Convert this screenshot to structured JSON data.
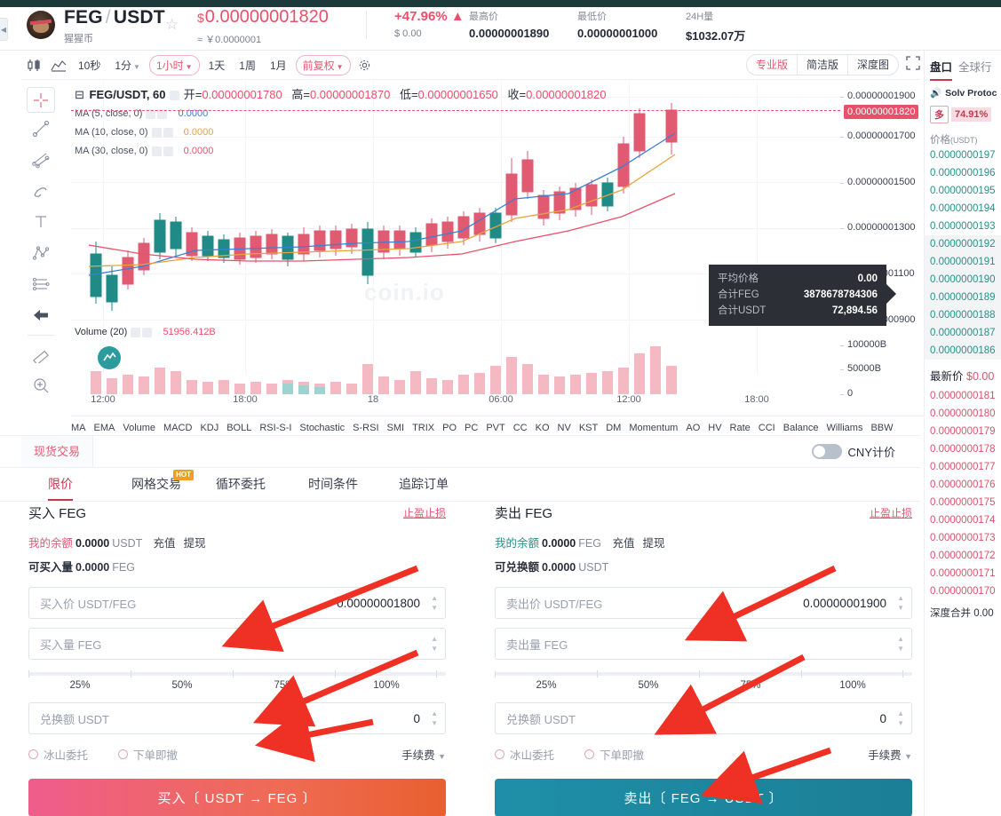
{
  "header": {
    "base": "FEG",
    "slash": "/",
    "quote": "USDT",
    "coin_cn_name": "猩猩币",
    "star_icon": "star-icon",
    "price_currency": "$",
    "price": "0.00000001820",
    "price_cny_approx": "≈ ￥0.0000001",
    "change_pct": "+47.96%",
    "change_arrow": "▲",
    "change_usd": "$ 0.00",
    "stats": [
      {
        "label": "最高价",
        "value": "0.00000001890"
      },
      {
        "label": "最低价",
        "value": "0.00000001000"
      },
      {
        "label": "24H量",
        "value": "$1032.07万"
      }
    ]
  },
  "chart_toolbar": {
    "candle_icon": "candlestick-icon",
    "indicator_icon": "indicator-chart-icon",
    "intervals": [
      {
        "label": "10秒",
        "active": false,
        "caret": false
      },
      {
        "label": "1分",
        "active": false,
        "caret": true
      },
      {
        "label": "1小时",
        "active": true,
        "caret": true
      },
      {
        "label": "1天",
        "active": false,
        "caret": false
      },
      {
        "label": "1周",
        "active": false,
        "caret": false
      },
      {
        "label": "1月",
        "active": false,
        "caret": false
      }
    ],
    "adjust": {
      "label": "前复权",
      "caret": true
    },
    "settings_icon": "gear-icon",
    "views": [
      {
        "label": "专业版",
        "active": true
      },
      {
        "label": "简洁版",
        "active": false
      },
      {
        "label": "深度图",
        "active": false
      }
    ],
    "fullscreen_icon": "fullscreen-icon"
  },
  "left_tools": [
    "crosshair-icon",
    "trendline-icon",
    "fib-fork-icon",
    "brush-icon",
    "text-icon",
    "pitchfork-icon",
    "parallel-channel-icon",
    "arrow-left-icon",
    "ruler-icon",
    "zoom-in-icon"
  ],
  "chart": {
    "title": "FEG/USDT, 60",
    "gear_icon": "gear-icon",
    "ohlc": [
      {
        "label": "开=",
        "value": "0.00000001780"
      },
      {
        "label": "高=",
        "value": "0.00000001870"
      },
      {
        "label": "低=",
        "value": "0.00000001650"
      },
      {
        "label": "收=",
        "value": "0.00000001820"
      }
    ],
    "ma_rows": [
      {
        "label": "MA (5, close, 0)",
        "value": "0.0000",
        "color": "#3b7fd4"
      },
      {
        "label": "MA (10, close, 0)",
        "value": "0.0000",
        "color": "#e8a33d"
      },
      {
        "label": "MA (30, close, 0)",
        "value": "0.0000",
        "color": "#e8516a"
      }
    ],
    "watermark": "coin.io",
    "price_ticks": [
      "0.00000001900",
      "0.00000001700",
      "0.00000001500",
      "0.00000001300",
      "0.00000001100",
      "0.00000000900"
    ],
    "price_badge": "0.00000001820",
    "volume": {
      "title": "Volume (20)",
      "value": "51956.412B",
      "ticks": [
        "100000B",
        "50000B",
        "0"
      ]
    },
    "time_ticks": [
      "12:00",
      "18:00",
      "18",
      "06:00",
      "12:00",
      "18:00"
    ],
    "tooltip": [
      {
        "key": "平均价格",
        "value": "0.00"
      },
      {
        "key": "合计FEG",
        "value": "3878678784306"
      },
      {
        "key": "合计USDT",
        "value": "72,894.56"
      }
    ],
    "indicators": [
      "MA",
      "EMA",
      "Volume",
      "MACD",
      "KDJ",
      "BOLL",
      "RSI-S-I",
      "Stochastic",
      "S-RSI",
      "SMI",
      "TRIX",
      "PO",
      "PC",
      "PVT",
      "CC",
      "KO",
      "NV",
      "KST",
      "DM",
      "Momentum",
      "AO",
      "HV",
      "Rate",
      "CCI",
      "Balance",
      "Williams",
      "BBW"
    ]
  },
  "trade": {
    "spot_tab": "现货交易",
    "cny_label": "CNY计价",
    "order_tabs": [
      {
        "label": "限价",
        "active": true,
        "badge": ""
      },
      {
        "label": "网格交易",
        "active": false,
        "badge": "HOT"
      },
      {
        "label": "循环委托",
        "active": false,
        "badge": ""
      },
      {
        "label": "时间条件",
        "active": false,
        "badge": ""
      },
      {
        "label": "追踪订单",
        "active": false,
        "badge": ""
      }
    ],
    "buy": {
      "title": "买入 FEG",
      "tp_sl": "止盈止损",
      "balance_label": "我的余额",
      "balance_amount": "0.0000",
      "balance_unit": "USDT",
      "deposit": "充值",
      "withdraw": "提现",
      "avail_label": "可买入量",
      "avail_amount": "0.0000",
      "avail_unit": "FEG",
      "price_placeholder": "买入价 USDT/FEG",
      "price_value": "0.00000001800",
      "amount_placeholder": "买入量 FEG",
      "amount_value": "",
      "percents": [
        "25%",
        "50%",
        "75%",
        "100%"
      ],
      "total_placeholder": "兑换额 USDT",
      "total_value": "0",
      "opt_iceberg": "冰山委托",
      "opt_ioc": "下单即撤",
      "fee_label": "手续费",
      "submit": "买入〔 USDT → FEG 〕"
    },
    "sell": {
      "title": "卖出 FEG",
      "tp_sl": "止盈止损",
      "balance_label": "我的余额",
      "balance_amount": "0.0000",
      "balance_unit": "FEG",
      "deposit": "充值",
      "withdraw": "提现",
      "avail_label": "可兑换额",
      "avail_amount": "0.0000",
      "avail_unit": "USDT",
      "price_placeholder": "卖出价 USDT/FEG",
      "price_value": "0.00000001900",
      "amount_placeholder": "卖出量 FEG",
      "amount_value": "",
      "percents": [
        "25%",
        "50%",
        "75%",
        "100%"
      ],
      "total_placeholder": "兑换额 USDT",
      "total_value": "0",
      "opt_iceberg": "冰山委托",
      "opt_ioc": "下单即撤",
      "fee_label": "手续费",
      "submit": "卖出〔 FEG → USDT 〕"
    }
  },
  "sidebar": {
    "tabs": [
      {
        "label": "盘口",
        "active": true
      },
      {
        "label": "全球行",
        "active": false
      }
    ],
    "news_icon": "speaker-icon",
    "news_text": "Solv Protoc",
    "ratio_tag": "多",
    "ratio_value": "74.91%",
    "col_header_main": "价格",
    "col_header_unit": "(USDT)",
    "asks": [
      "0.0000000197",
      "0.0000000196",
      "0.0000000195",
      "0.0000000194",
      "0.0000000193",
      "0.0000000192",
      "0.0000000191",
      "0.0000000190",
      "0.0000000189",
      "0.0000000188",
      "0.0000000187",
      "0.0000000186"
    ],
    "last_label": "最新价",
    "last_price": "$0.00",
    "bids": [
      "0.0000000181",
      "0.0000000180",
      "0.0000000179",
      "0.0000000178",
      "0.0000000177",
      "0.0000000176",
      "0.0000000175",
      "0.0000000174",
      "0.0000000173",
      "0.0000000172",
      "0.0000000171",
      "0.0000000170"
    ],
    "depth_label": "深度合并",
    "depth_value": "0.00"
  },
  "colors": {
    "up_red": "#e8516a",
    "down_teal": "#2b8f8a",
    "accent": "#c0394f",
    "arrow": "#ee3124"
  }
}
